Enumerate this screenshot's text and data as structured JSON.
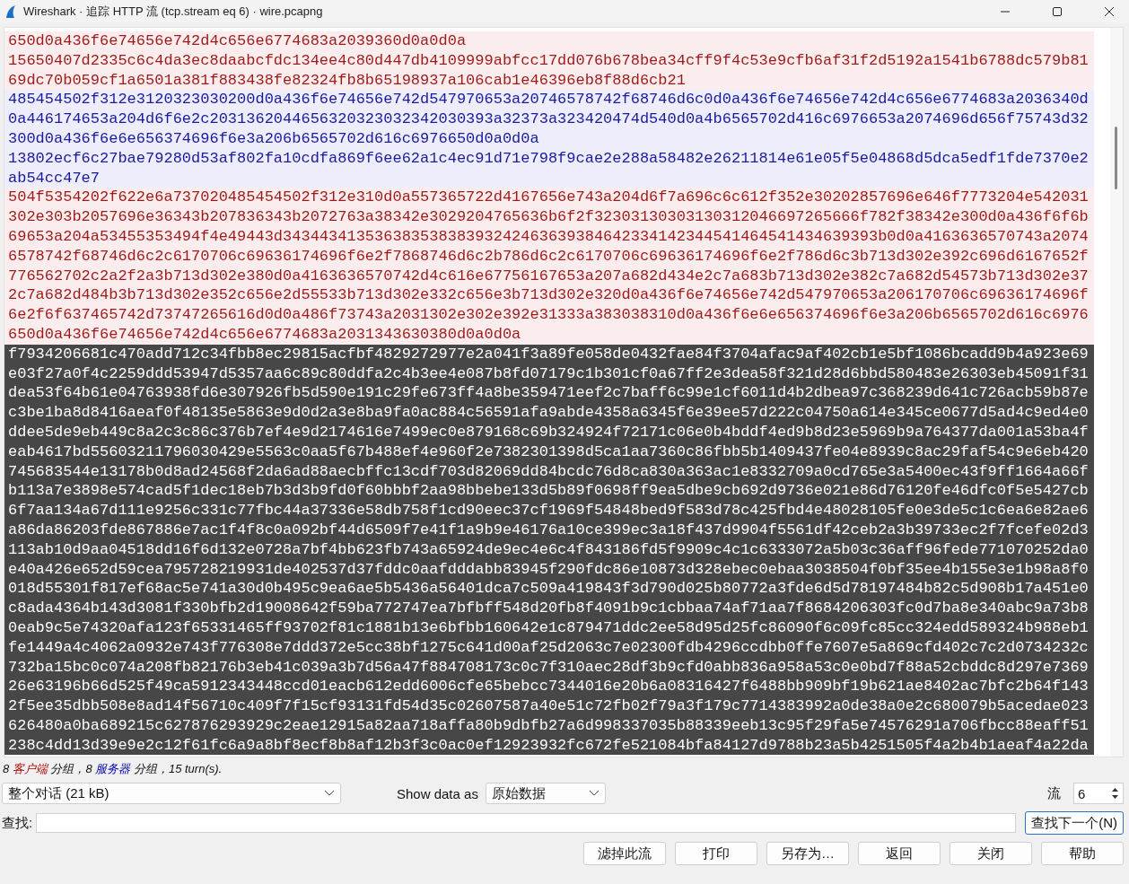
{
  "window": {
    "title": "Wireshark · 追踪 HTTP 流 (tcp.stream eq 6) · wire.pcapng"
  },
  "segments": [
    {
      "kind": "client",
      "selected": false,
      "text": "650d0a436f6e74656e742d4c656e6774683a2039360d0a0d0a"
    },
    {
      "kind": "client",
      "selected": false,
      "text": "15650407d2335c6c4da3ec8daabcfdc134ee4c80d447db4109999abfcc17dd076b678bea34cff9f4c53e9cfb6af31f2d5192a1541b6788dc579b8169dc70b059cf1a6501a381f883438fe82324fb8b65198937a106cab1e46396eb8f88d6cb21"
    },
    {
      "kind": "server",
      "selected": false,
      "text": "485454502f312e3120323030200d0a436f6e74656e742d547970653a20746578742f68746d6c0d0a436f6e74656e742d4c656e6774683a2036340d0a446174653a204d6f6e2c2031362044656320323032342030393a32373a323420474d540d0a4b6565702d416c6976653a2074696d656f75743d32300d0a436f6e6e656374696f6e3a206b6565702d616c6976650d0a0d0a"
    },
    {
      "kind": "server",
      "selected": false,
      "text": "13802ecf6c27bae79280d53af802fa10cdfa869f6ee62a1c4ec91d71e798f9cae2e288a58482e26211814e61e05f5e04868d5dca5edf1fde7370e2ab54cc47e7"
    },
    {
      "kind": "client",
      "selected": false,
      "text": "504f5354202f622e6a737020485454502f312e310d0a557365722d4167656e743a204d6f7a696c6c612f352e30202857696e646f7773204e542031302e303b2057696e36343b207836343b2072763a38342e3029204765636b6f2f32303130303130312046697265666f782f38342e300d0a436f6f6b69653a204a53455353494f4e49443d34344341353638353838393242463639384642334142344541464541434639393b0d0a4163636570743a20746578742f68746d6c2c6170706c69636174696f6e2f7868746d6c2b786d6c2c6170706c69636174696f6e2f786d6c3b713d302e392c696d6167652f776562702c2a2f2a3b713d302e380d0a4163636570742d4c616e67756167653a207a682d434e2c7a683b713d302e382c7a682d54573b713d302e372c7a682d484b3b713d302e352c656e2d55533b713d302e332c656e3b713d302e320d0a436f6e74656e742d547970653a206170706c69636174696f6e2f6f637465742d73747265616d0d0a486f73743a2031302e302e392e31333a383038310d0a436f6e6e656374696f6e3a206b6565702d616c6976650d0a436f6e74656e742d4c656e6774683a2031343630380d0a0d0a"
    },
    {
      "kind": "client",
      "selected": true,
      "text": "f7934206681c470add712c34fbb8ec29815acfbf4829272977e2a041f3a89fe058de0432fae84f3704afac9af402cb1e5bf1086bcadd9b4a923e69e03f27a0f4c2259ddd53947d5357aa6c89c80ddfa2c4b3ee4e087b8fd07179c1b301cf0a67ff2e3dea58f321d28d6bbd580483e26303eb45091f31dea53f64b61e04763938fd6e307926fb5d590e191c29fe673ff4a8be359471eef2c7baff6c99e1cf6011d4b2dbea97c368239d641c726acb59b87ec3be1ba8d8416aeaf0f48135e5863e9d0d2a3e8ba9fa0ac884c56591afa9abde4358a6345f6e39ee57d222c04750a614e345ce0677d5ad4c9ed4e0ddee5de9eb449c8a2c3c86c376b7ef4e9d2174616e7499ec0e879168c69b324924f72171c06e0b4bddf4ed9b8d23e5969b9a764377da001a53ba4feab4617bd55603211796030429e5563c0aa5f67b488ef4e960f2e7382301398d5ca1aa7360c86fbb5b1409437fe04e8939c8ac29faf54c9e6eb420745683544e13178b0d8ad24568f2da6ad88aecbffc13cdf703d82069dd84bcdc76d8ca830a363ac1e8332709a0cd765e3a5400ec43f9ff1664a66fb113a7e3898e574cad5f1dec18eb7b3d3b9fd0f60bbbf2aa98bbebe133d5b89f0698ff9ea5dbe9cb692d9736e021e86d76120fe46dfc0f5e5427cb6f7aa134a67d111e9256c331c77fbc44a37336e58db758f1cd90eec37cf1969f54848bed9f583d78c425fbd4e48028105fe0e3de5c1c6ea6e82ae6a86da86203fde867886e7ac1f4f8c0a092bf44d6509f7e41f1a9b9e46176a10ce399ec3a18f437d9904f5561df42ceb2a3b39733ec2f7fcefe02d3113ab10d9aa04518dd16f6d132e0728a7bf4bb623fb743a65924de9ec4e6c4f843186fd5f9909c4c1c6333072a5b03c36aff96fede771070252da0e40a426e652d59cea795728219931de402537d37fddc0aafdddabb83945f290fdc86e10873d328ebec0ebaa3038504f0bf35ee4b155e3e1b98a8f0018d55301f817ef68ac5e741a30d0b495c9ea6ae5b5436a56401dca7c509a419843f3d790d025b80772a3fde6d5d78197484b82c5d908b17a451e0c8ada4364b143d3081f330bfb2d19008642f59ba772747ea7bfbff548d20fb8f4091b9c1cbbaa74af71aa7f8684206303fc0d7ba8e340abc9a73b80eab9c5e74320afa123f65331465ff93702f81c1881b13e6bfbb160642e1c879471ddc2ee58d95d25fc86090f6c09fc85cc324edd589324b988eb1fe1449a4c4062a0932e743f776308e7ddd372e5cc38bf1275c641d00af25d2063c7e02300fdb4296ccdbb0ffe7607e5a869cfd402c7c2d0734232c732ba15bc0c074a208fb82176b3eb41c039a3b7d56a47f884708173c0c7f310aec28df3b9cfd0abb836a958a53c0e0bd7f88a52cbddc8d297e736926e63196b66d525f49ca5912343448ccd01eacb612edd6006cfe65bebcc7344016e20b6a08316427f6488bb909bf19b621ae8402ac7bfc2b64f1432f5ee35dbb508e8ad14f56710c409f7f15cf93131fd54d35c02607587a40e51c72fb02f79a3f179c7714383992a0de38a0e2c680079b5acedae023626480a0ba689215c627876293929c2eae12915a82aa718affa80b9dbfb27a6d998337035b88339eeb13c95f29fa5e74576291a706fbcc88eaff51238c4dd13d39e9e2c12f61fc6a9a8bf8ecf8b8af12b3f3c0ac0ef12923932fc672fe521084bfa84127d9788b23a5b4251505f4a2b4b1aeaf4a22da"
    }
  ],
  "status_line": [
    {
      "kind": "plain",
      "text": "8 "
    },
    {
      "kind": "client",
      "text": "客户端"
    },
    {
      "kind": "plain",
      "text": " 分组，8 "
    },
    {
      "kind": "server",
      "text": "服务器"
    },
    {
      "kind": "plain",
      "text": " 分组，15 turn(s)."
    }
  ],
  "conversation": {
    "value": "整个对话 (21 kB)"
  },
  "show_data_as": {
    "label": "Show data as",
    "value": "原始数据"
  },
  "stream": {
    "label": "流",
    "value": "6"
  },
  "find": {
    "label": "查找:",
    "button": "查找下一个(N)"
  },
  "buttons": [
    "滤掉此流",
    "打印",
    "另存为…",
    "返回",
    "关闭",
    "帮助"
  ]
}
